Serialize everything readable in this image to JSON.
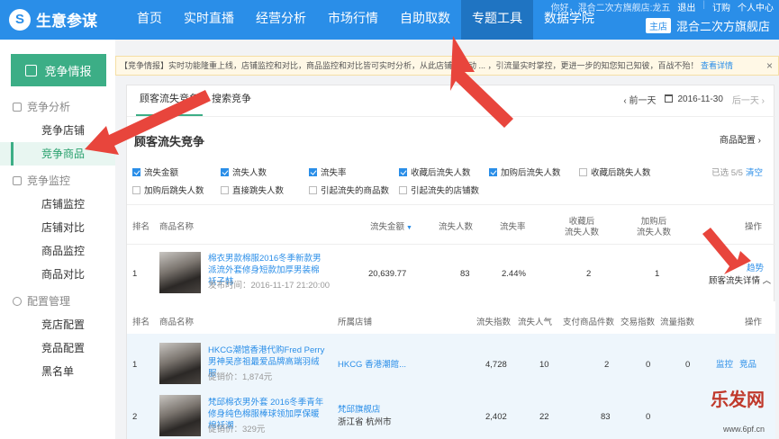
{
  "app": {
    "title": "生意参谋",
    "logo_glyph": "S"
  },
  "nav": {
    "items": [
      "首页",
      "实时直播",
      "经营分析",
      "市场行情",
      "自助取数",
      "专题工具",
      "数据学院"
    ],
    "active_index": 5
  },
  "top_right": {
    "greeting": "你好，混合二次方旗舰店:龙五",
    "logout": "退出",
    "order": "订购",
    "personal": "个人中心",
    "shop_badge": "主店",
    "shop_name": "混合二次方旗舰店"
  },
  "sidebar": {
    "header": "竞争情报",
    "groups": [
      {
        "title": "竞争分析",
        "icon": "chart-icon",
        "items": [
          "竞争店铺",
          "竞争商品"
        ]
      },
      {
        "title": "竞争监控",
        "icon": "monitor-icon",
        "items": [
          "店铺监控",
          "店铺对比",
          "商品监控",
          "商品对比"
        ]
      },
      {
        "title": "配置管理",
        "icon": "gear-icon",
        "items": [
          "竞店配置",
          "竞品配置",
          "黑名单"
        ]
      }
    ],
    "active_item": "竞争商品"
  },
  "notice": {
    "text": "【竞争情报】实时功能隆重上线，店铺监控和对比，商品监控和对比皆可实时分析，从此店铺微活动 ... ，引流量实时掌控，更进一步的知您知己知彼，百战不殆！",
    "more": "查看详情",
    "close": "×"
  },
  "tabs": [
    "顾客流失竞争",
    "搜索竞争"
  ],
  "date_nav": {
    "prev": "前一天",
    "date": "2016-11-30",
    "next": "后一天"
  },
  "section": {
    "title": "顾客流失竞争",
    "config": "商品配置 ›"
  },
  "checkboxes": [
    {
      "label": "流失金额",
      "checked": true
    },
    {
      "label": "流失人数",
      "checked": true
    },
    {
      "label": "流失率",
      "checked": true
    },
    {
      "label": "收藏后流失人数",
      "checked": true
    },
    {
      "label": "加购后流失人数",
      "checked": true
    },
    {
      "label": "收藏后跳失人数",
      "checked": false
    },
    {
      "label": "加购后跳失人数",
      "checked": false
    },
    {
      "label": "直接跳失人数",
      "checked": false
    },
    {
      "label": "引起流失的商品数",
      "checked": false
    },
    {
      "label": "引起流失的店铺数",
      "checked": false
    }
  ],
  "selection": {
    "count": "已选 5/5",
    "clear": "清空"
  },
  "main_table": {
    "headers": [
      "排名",
      "商品名称",
      "流失金额",
      "流失人数",
      "流失率",
      "收藏后\n流失人数",
      "加购后\n流失人数",
      "操作"
    ],
    "rows": [
      {
        "rank": "1",
        "title": "棉衣男款棉服2016冬季新款男派流外套修身短款加厚男装棉袄子韩",
        "published": "发布时间：2016-11-17 21:20:00",
        "amount": "20,639.77",
        "people": "83",
        "rate": "2.44%",
        "fav_lost": "2",
        "cart_lost": "1",
        "action_trend": "趋势",
        "action_detail": "顾客流失详情 ︿"
      }
    ]
  },
  "sub_table": {
    "headers": [
      "排名",
      "商品名称",
      "所属店铺",
      "流失指数",
      "流失人气",
      "支付商品件数",
      "交易指数",
      "流量指数",
      "操作"
    ],
    "rows": [
      {
        "rank": "1",
        "title": "HKCG潮馆香港代购Fred Perry 男神吴彦祖最爱品牌高端羽绒服",
        "price": "促销价：1,874元",
        "shop": "HKCG 香港潮館...",
        "shop_loc": "",
        "lost_index": "4,728",
        "lost_pop": "10",
        "paid": "2",
        "trade": "0",
        "flow": "0",
        "actions": [
          "监控",
          "竞品"
        ]
      },
      {
        "rank": "2",
        "title": "梵邱棉衣男外套 2016冬季青年修身纯色棉服棒球领加厚保暖棉袄潮",
        "price": "促销价：329元",
        "shop": "梵邱旗舰店",
        "shop_loc": "浙江省 杭州市",
        "lost_index": "2,402",
        "lost_pop": "22",
        "paid": "83",
        "trade": "0",
        "flow": "",
        "actions": []
      }
    ]
  },
  "watermark": {
    "brand": "乐发网",
    "url": "www.6pf.cn"
  },
  "colors": {
    "nav": "#2a8ee8",
    "accent": "#3cae86",
    "link": "#2a8ee8",
    "arrow": "#e8453c"
  }
}
